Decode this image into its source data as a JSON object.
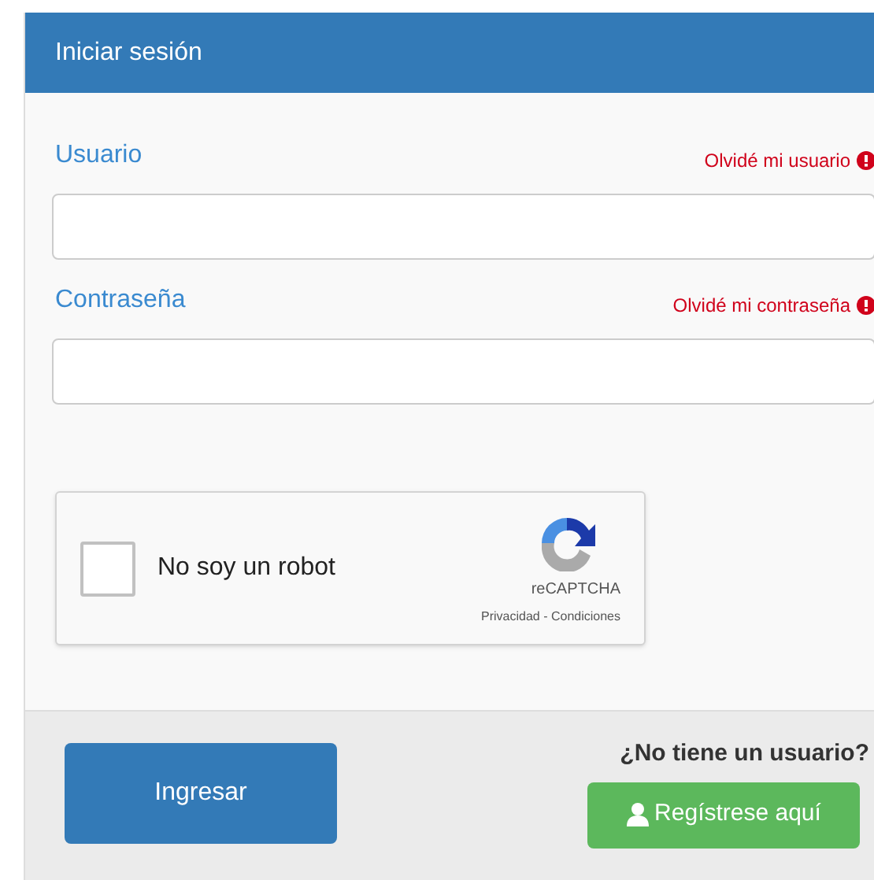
{
  "panel": {
    "title": "Iniciar sesión"
  },
  "fields": [
    {
      "label": "Usuario",
      "link": "Olvidé mi usuario"
    },
    {
      "label": "Contraseña",
      "link": "Olvidé mi contraseña"
    }
  ],
  "captcha": {
    "label": "No soy un robot",
    "checked": false,
    "brand": "reCAPTCHA",
    "terms": "Privacidad - Condiciones"
  },
  "footer": {
    "submit": "Ingresar",
    "prompt": "¿No tiene un usuario?",
    "register": "Regístrese aquí"
  }
}
